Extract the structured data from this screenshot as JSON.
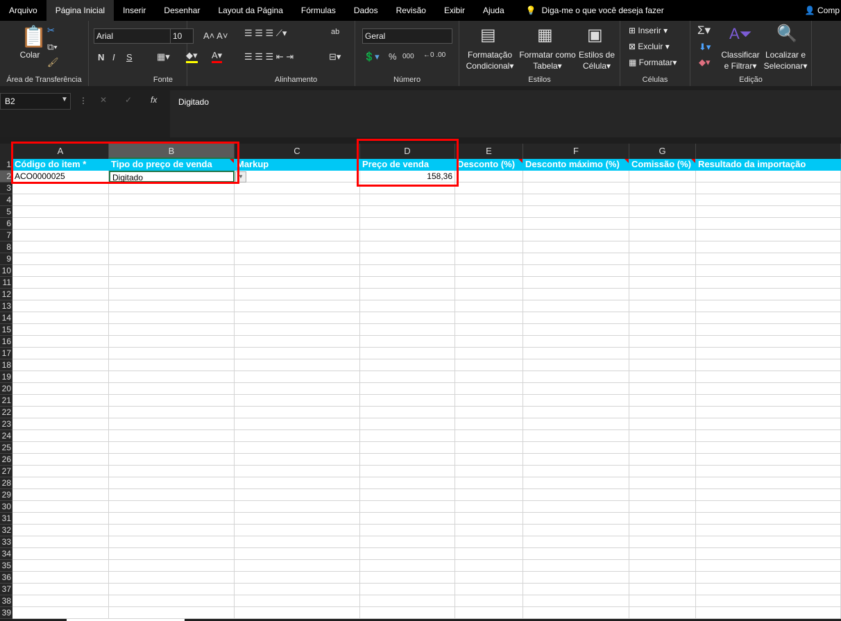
{
  "menu": {
    "tabs": [
      "Arquivo",
      "Página Inicial",
      "Inserir",
      "Desenhar",
      "Layout da Página",
      "Fórmulas",
      "Dados",
      "Revisão",
      "Exibir",
      "Ajuda"
    ],
    "active": "Página Inicial",
    "tell_me": "Diga-me o que você deseja fazer",
    "share": "Comp"
  },
  "ribbon": {
    "clipboard": {
      "label": "Área de Transferência",
      "paste": "Colar"
    },
    "font": {
      "label": "Fonte",
      "name": "Arial",
      "size": "10",
      "bold": "N",
      "italic": "I",
      "underline": "S"
    },
    "alignment": {
      "label": "Alinhamento"
    },
    "number": {
      "label": "Número",
      "format": "Geral",
      "percent": "%",
      "thousands": "000"
    },
    "styles": {
      "label": "Estilos",
      "conditional": [
        "Formatação",
        "Condicional"
      ],
      "as_table": [
        "Formatar como",
        "Tabela"
      ],
      "cell_styles": [
        "Estilos de",
        "Célula"
      ]
    },
    "cells": {
      "label": "Células",
      "insert": "Inserir",
      "delete": "Excluir",
      "format": "Formatar"
    },
    "editing": {
      "label": "Edição",
      "sort": [
        "Classificar",
        "e Filtrar"
      ],
      "find": [
        "Localizar e",
        "Selecionar"
      ]
    }
  },
  "formula_bar": {
    "name_box": "B2",
    "formula": "Digitado"
  },
  "sheet": {
    "columns": [
      "A",
      "B",
      "C",
      "D",
      "E",
      "F",
      "G",
      ""
    ],
    "selected_column": "B",
    "headers": [
      "Código do item *",
      "Tipo do preço de venda",
      "Markup",
      "Preço de venda",
      "Desconto (%)",
      "Desconto máximo (%)",
      "Comissão (%)",
      "Resultado da importação"
    ],
    "row2": [
      "ACO0000025",
      "Digitado",
      "",
      "158,36",
      "",
      "",
      "",
      ""
    ],
    "row_count": 39,
    "accent": "#00c8f5"
  }
}
